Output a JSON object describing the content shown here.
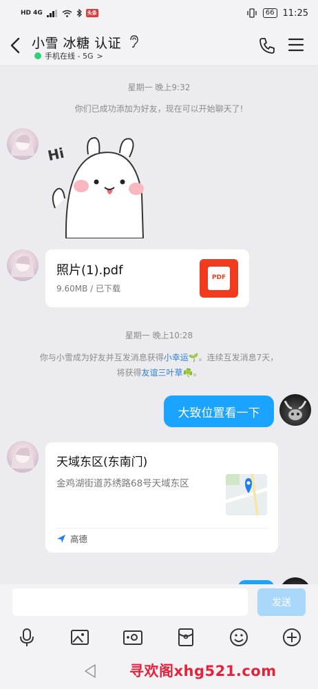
{
  "status_bar": {
    "left_icons": "HD 4G",
    "app_badge": "头条",
    "battery": "66",
    "time": "11:25"
  },
  "header": {
    "title": "小雪  冰糖  认证",
    "presence": "手机在线 - 5G",
    "presence_arrow": ">"
  },
  "messages": {
    "time1": "星期一 晚上9:32",
    "added_note": "你们已成功添加为好友，现在可以开始聊天了!",
    "sticker_text": "Hi",
    "file": {
      "name": "照片(1).pdf",
      "meta": "9.60MB / 已下载",
      "icon_label": "PDF"
    },
    "time2": "星期一 晚上10:28",
    "streak_note_a": "你与小雪成为好友并互发消息获得",
    "streak_link_a": "小幸运🌱",
    "streak_note_b": "。连续互发消息7天，",
    "streak_note_c": "将获得",
    "streak_link_b": "友谊三叶草☘️",
    "streak_note_d": "。",
    "my_bubble": "大致位置看一下",
    "location": {
      "title": "天域东区(东南门)",
      "address": "金鸡湖街道苏绣路68号天域东区",
      "provider": "高德"
    }
  },
  "input": {
    "placeholder": "",
    "send_label": "发送"
  },
  "toolbar": [
    "mic-icon",
    "image-icon",
    "camera-icon",
    "red-packet-icon",
    "emoji-icon",
    "plus-icon"
  ],
  "watermark": "寻欢阁xhg521.com",
  "colors": {
    "accent": "#1aa3ff",
    "link": "#2a7fd8",
    "online": "#2fd175",
    "pdf": "#f03b1f"
  }
}
